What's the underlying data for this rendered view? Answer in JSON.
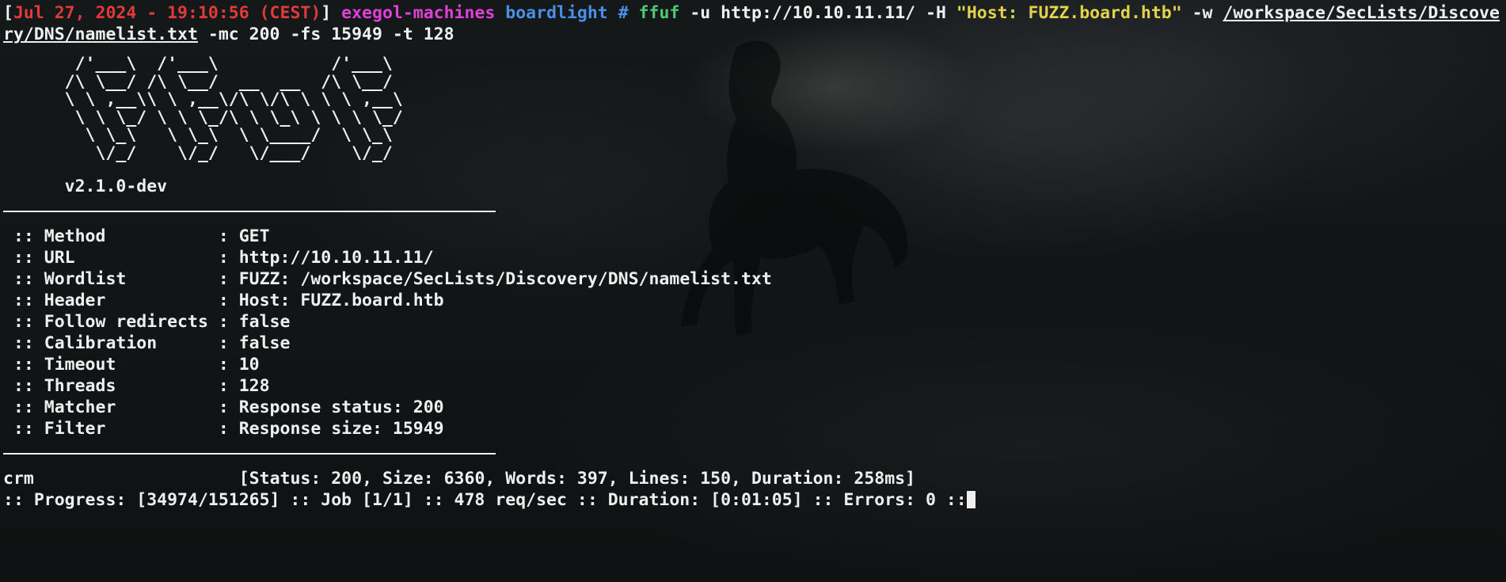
{
  "prompt": {
    "date": "Jul 27, 2024 - 19:10:56 (CEST)",
    "machine": "exegol-machines",
    "path": "boardlight",
    "symbol": "#",
    "command": "ffuf",
    "args_1": " -u http://10.10.11.11/ -H ",
    "host_string": "\"Host: FUZZ.board.htb\"",
    "args_2": " -w ",
    "wordlist_part1": "/workspace/SecLists/Discove",
    "wordlist_part2": "ry/DNS/namelist.txt",
    "args_3": " -mc 200 -fs 15949 -t 128"
  },
  "banner": {
    "logo_lines": [
      "       /'___\\  /'___\\           /'___\\       ",
      "      /\\ \\__/ /\\ \\__/  __  __  /\\ \\__/       ",
      "      \\ \\ ,__\\\\ \\ ,__\\/\\ \\/\\ \\ \\ \\ ,__\\      ",
      "       \\ \\ \\_/ \\ \\ \\_/\\ \\ \\_\\ \\ \\ \\ \\_/      ",
      "        \\ \\_\\   \\ \\_\\  \\ \\____/  \\ \\_\\       ",
      "         \\/_/    \\/_/   \\/___/    \\/_/       "
    ],
    "version": "v2.1.0-dev"
  },
  "config": [
    {
      "label": " :: Method           : ",
      "value": "GET"
    },
    {
      "label": " :: URL              : ",
      "value": "http://10.10.11.11/"
    },
    {
      "label": " :: Wordlist         : ",
      "value": "FUZZ: /workspace/SecLists/Discovery/DNS/namelist.txt"
    },
    {
      "label": " :: Header           : ",
      "value": "Host: FUZZ.board.htb"
    },
    {
      "label": " :: Follow redirects : ",
      "value": "false"
    },
    {
      "label": " :: Calibration      : ",
      "value": "false"
    },
    {
      "label": " :: Timeout          : ",
      "value": "10"
    },
    {
      "label": " :: Threads          : ",
      "value": "128"
    },
    {
      "label": " :: Matcher          : ",
      "value": "Response status: 200"
    },
    {
      "label": " :: Filter           : ",
      "value": "Response size: 15949"
    }
  ],
  "result": {
    "word": "crm",
    "details": "[Status: 200, Size: 6360, Words: 397, Lines: 150, Duration: 258ms]"
  },
  "progress": ":: Progress: [34974/151265] :: Job [1/1] :: 478 req/sec :: Duration: [0:01:05] :: Errors: 0 ::",
  "colors": {
    "date": "#e23a3a",
    "machine": "#e040d8",
    "path": "#4a8fe8",
    "command": "#50c878",
    "string": "#e4d24a",
    "text": "#efefef",
    "background": "#101214"
  }
}
